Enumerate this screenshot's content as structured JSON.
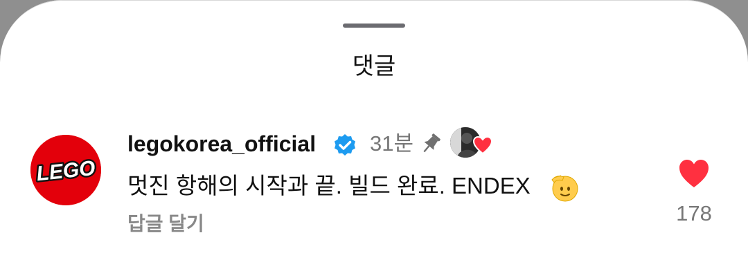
{
  "sheet": {
    "title": "댓글"
  },
  "comment": {
    "username": "legokorea_official",
    "verified": true,
    "time": "31분",
    "pinned": true,
    "liked_by_creator": true,
    "text": "멋진 항해의 시작과 끝. 빌드 완료. ENDEX",
    "emoji": "saluting-face",
    "reply_label": "답글 달기",
    "like_count": "178",
    "avatar_logo_text": "LEGO"
  },
  "colors": {
    "brand_red": "#e3000b",
    "verified_blue": "#1d9bf0",
    "heart_red": "#ff3040",
    "muted_text": "#777777"
  },
  "icons": {
    "verified": "verified-badge-icon",
    "pin": "pin-icon",
    "like": "heart-icon",
    "creator_like": "creator-heart-icon"
  }
}
